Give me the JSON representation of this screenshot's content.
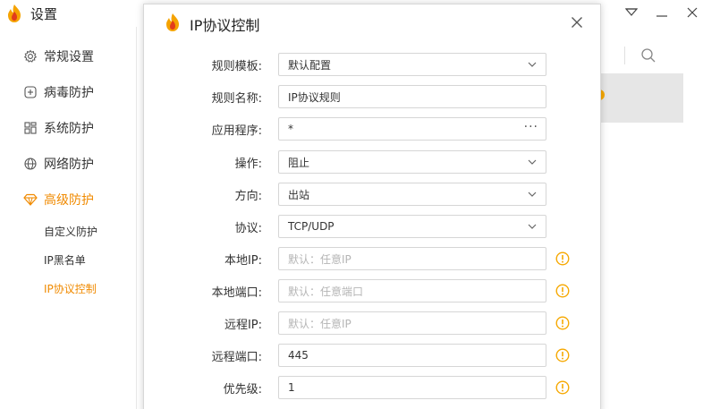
{
  "window": {
    "title": "设置"
  },
  "sidebar": {
    "items": [
      {
        "label": "常规设置",
        "icon": "gear-icon"
      },
      {
        "label": "病毒防护",
        "icon": "plus-square-icon"
      },
      {
        "label": "系统防护",
        "icon": "grid-icon"
      },
      {
        "label": "网络防护",
        "icon": "globe-icon"
      },
      {
        "label": "高级防护",
        "icon": "diamond-icon",
        "active": true
      }
    ],
    "sub_items": [
      {
        "label": "自定义防护"
      },
      {
        "label": "IP黑名单"
      },
      {
        "label": "IP协议控制",
        "active": true
      }
    ]
  },
  "dialog": {
    "title": "IP协议控制",
    "fields": [
      {
        "label": "规则模板:",
        "value": "默认配置",
        "kind": "select"
      },
      {
        "label": "规则名称:",
        "value": "IP协议规则",
        "kind": "text"
      },
      {
        "label": "应用程序:",
        "value": "*",
        "kind": "browse",
        "button": "···"
      },
      {
        "label": "操作:",
        "value": "阻止",
        "kind": "select"
      },
      {
        "label": "方向:",
        "value": "出站",
        "kind": "select"
      },
      {
        "label": "协议:",
        "value": "TCP/UDP",
        "kind": "select"
      },
      {
        "label": "本地IP:",
        "placeholder": "默认：任意IP",
        "kind": "text",
        "warn": true
      },
      {
        "label": "本地端口:",
        "placeholder": "默认：任意端口",
        "kind": "text",
        "warn": true
      },
      {
        "label": "远程IP:",
        "placeholder": "默认：任意IP",
        "kind": "text",
        "warn": true
      },
      {
        "label": "远程端口:",
        "value": "445",
        "kind": "text",
        "warn": true
      },
      {
        "label": "优先级:",
        "value": "1",
        "kind": "text",
        "warn": true
      }
    ]
  },
  "colors": {
    "accent": "#f08a00",
    "warn": "#f6a800"
  }
}
